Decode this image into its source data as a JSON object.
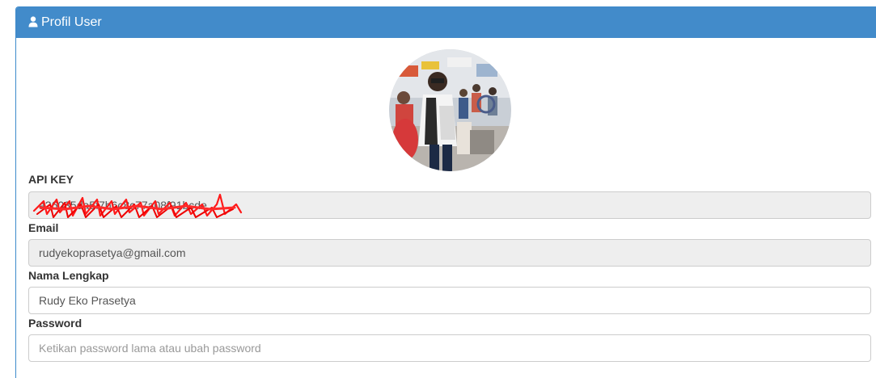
{
  "panel": {
    "title": "Profil User",
    "title_icon": "user-icon",
    "header_color": "#428bca"
  },
  "profile": {
    "avatar": "profile-photo"
  },
  "form": {
    "api_key": {
      "label": "API KEY",
      "value": "a26035da5f7b6c8c77a08f91bcde",
      "redacted": true
    },
    "email": {
      "label": "Email",
      "value": "rudyekoprasetya@gmail.com"
    },
    "full_name": {
      "label": "Nama Lengkap",
      "value": "Rudy Eko Prasetya"
    },
    "password": {
      "label": "Password",
      "value": "",
      "placeholder": "Ketikan password lama atau ubah password"
    }
  }
}
